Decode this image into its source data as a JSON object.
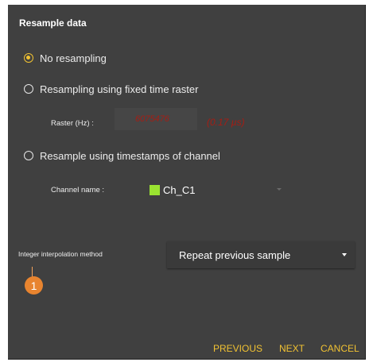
{
  "dialog": {
    "title": "Resample data",
    "options": [
      {
        "label": "No resampling",
        "selected": true
      },
      {
        "label": "Resampling using fixed time raster",
        "selected": false
      },
      {
        "label": "Resample using timestamps of channel",
        "selected": false
      }
    ],
    "raster": {
      "label": "Raster (Hz) :",
      "value": "6075476",
      "period": "(0.17 µs)"
    },
    "channel": {
      "label": "Channel name :",
      "value": "Ch_C1",
      "color": "#9ae331"
    },
    "interpolation": {
      "label": "Integer interpolation method",
      "value": "Repeat previous sample"
    },
    "callout": {
      "number": "1",
      "color": "#e8842f"
    },
    "footer": {
      "previous_label": "PREVIOUS",
      "next_label": "NEXT",
      "cancel_label": "CANCEL"
    },
    "colors": {
      "accent": "#f1c232",
      "background": "#404040",
      "disabled_value": "#a61d14"
    }
  }
}
